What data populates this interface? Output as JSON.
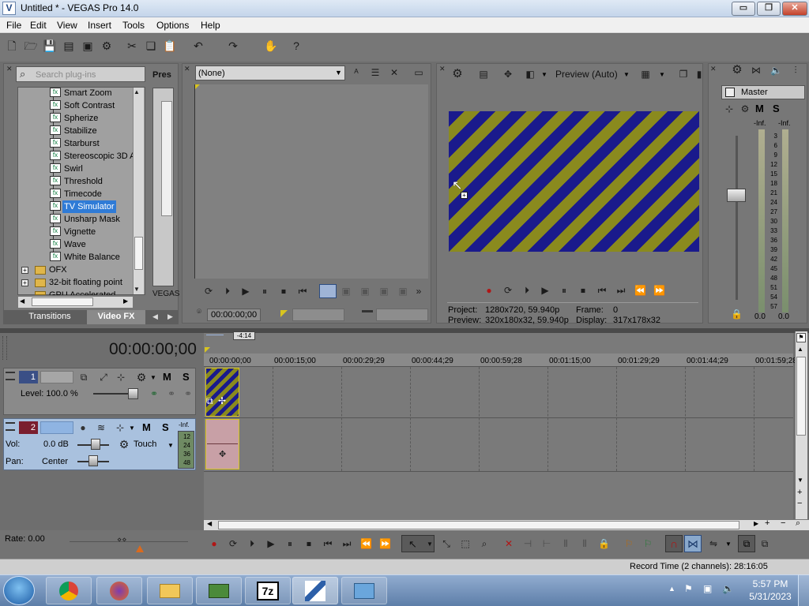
{
  "window": {
    "title": "Untitled * - VEGAS Pro 14.0",
    "app_icon": "vegas-icon"
  },
  "window_controls": {
    "minimize": "▭",
    "maximize": "❐",
    "close": "✕"
  },
  "menu": [
    "File",
    "Edit",
    "View",
    "Insert",
    "Tools",
    "Options",
    "Help"
  ],
  "plugins": {
    "search_placeholder": "Search plug-ins",
    "presets_header": "Pres",
    "vegas_label": "VEGAS",
    "items": [
      "Smart Zoom",
      "Soft Contrast",
      "Spherize",
      "Stabilize",
      "Starburst",
      "Stereoscopic 3D A",
      "Swirl",
      "Threshold",
      "Timecode",
      "TV Simulator",
      "Unsharp Mask",
      "Vignette",
      "Wave",
      "White Balance"
    ],
    "selected": "TV Simulator",
    "folders": [
      "OFX",
      "32-bit floating point",
      "GPU Accelerated"
    ],
    "tabs": [
      "Transitions",
      "Video FX"
    ]
  },
  "trimmer": {
    "dropdown_value": "(None)",
    "timecode": "00:00:00;00"
  },
  "preview": {
    "mode": "Preview (Auto)",
    "project_label": "Project:",
    "project_value": "1280x720, 59.940p",
    "preview_label": "Preview:",
    "preview_value": "320x180x32, 59.940p",
    "frame_label": "Frame:",
    "frame_value": "0",
    "display_label": "Display:",
    "display_value": "317x178x32",
    "stripe_colors": [
      "#1a1a8c",
      "#8a8a1e"
    ]
  },
  "master": {
    "title": "Master",
    "m": "M",
    "s": "S",
    "inf_left": "-Inf.",
    "inf_right": "-Inf.",
    "scale": [
      "3",
      "6",
      "9",
      "12",
      "15",
      "18",
      "21",
      "24",
      "27",
      "30",
      "33",
      "36",
      "39",
      "42",
      "45",
      "48",
      "51",
      "54",
      "57"
    ],
    "bottom_left": "0.0",
    "bottom_right": "0.0"
  },
  "timeline": {
    "timecode": "00:00:00;00",
    "marker": "-4:14",
    "ruler": [
      "00:00:00;00",
      "00:00:15;00",
      "00:00:29;29",
      "00:00:44;29",
      "00:00:59;28",
      "00:01:15;00",
      "00:01:29;29",
      "00:01:44;29",
      "00:01:59;28"
    ],
    "video_track": {
      "number": "1",
      "level_label": "Level: 100.0 %",
      "m": "M",
      "s": "S"
    },
    "audio_track": {
      "number": "2",
      "vol_label": "Vol:",
      "vol_value": "0.0 dB",
      "pan_label": "Pan:",
      "pan_value": "Center",
      "automation": "Touch",
      "m": "M",
      "s": "S",
      "meter_labels": [
        "-Inf.",
        "12",
        "24",
        "36",
        "48"
      ]
    },
    "rate": "Rate: 0.00",
    "record_time": "Record Time (2 channels): 28:16:05"
  },
  "taskbar": {
    "time": "5:57 PM",
    "date": "5/31/2023",
    "apps": [
      "Chrome",
      "Firefox",
      "File Explorer",
      "Network Tool",
      "7-Zip",
      "VEGAS Pro",
      "Control Panel"
    ]
  }
}
